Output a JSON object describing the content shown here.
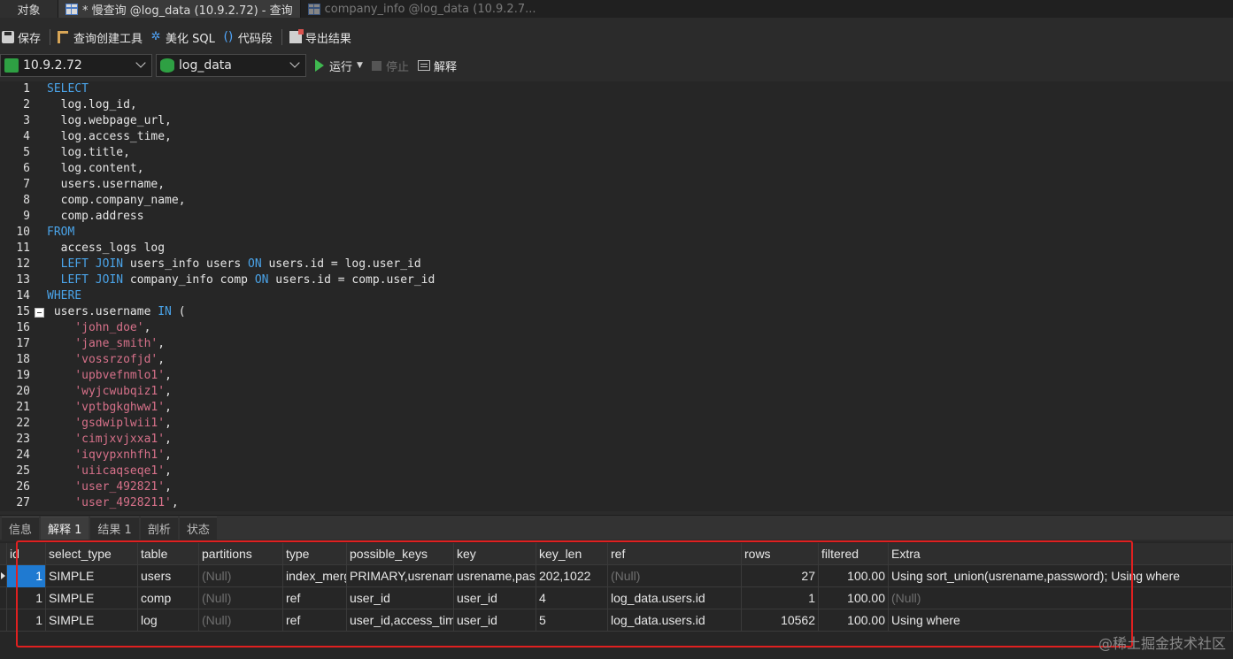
{
  "tabs": [
    {
      "label": "对象",
      "state": "objects"
    },
    {
      "label": "* 慢查询 @log_data (10.9.2.72) - 查询",
      "state": "active"
    },
    {
      "label": "company_info @log_data (10.9.2.7...",
      "state": "inactive"
    }
  ],
  "toolbar": {
    "save": "保存",
    "query_builder": "查询创建工具",
    "beautify": "美化 SQL",
    "snippet": "代码段",
    "export": "导出结果"
  },
  "connection": {
    "value": "10.9.2.72"
  },
  "database": {
    "value": "log_data"
  },
  "run": {
    "label": "运行",
    "stop": "停止",
    "explain": "解释"
  },
  "editor": {
    "lines": [
      [
        {
          "t": "SELECT",
          "c": "kw"
        }
      ],
      [
        {
          "t": "  log.log_id,"
        }
      ],
      [
        {
          "t": "  log.webpage_url,"
        }
      ],
      [
        {
          "t": "  log.access_time,"
        }
      ],
      [
        {
          "t": "  log.title,"
        }
      ],
      [
        {
          "t": "  log.content,"
        }
      ],
      [
        {
          "t": "  users.username,"
        }
      ],
      [
        {
          "t": "  comp.company_name,"
        }
      ],
      [
        {
          "t": "  comp.address"
        }
      ],
      [
        {
          "t": "FROM",
          "c": "kw"
        }
      ],
      [
        {
          "t": "  access_logs log"
        }
      ],
      [
        {
          "t": "  "
        },
        {
          "t": "LEFT JOIN",
          "c": "kw"
        },
        {
          "t": " users_info users "
        },
        {
          "t": "ON",
          "c": "kw"
        },
        {
          "t": " users.id = log.user_id"
        }
      ],
      [
        {
          "t": "  "
        },
        {
          "t": "LEFT JOIN",
          "c": "kw"
        },
        {
          "t": " company_info comp "
        },
        {
          "t": "ON",
          "c": "kw"
        },
        {
          "t": " users.id = comp.user_id"
        }
      ],
      [
        {
          "t": "WHERE",
          "c": "kw"
        }
      ],
      [
        {
          "t": " users.username "
        },
        {
          "t": "IN",
          "c": "kw"
        },
        {
          "t": " ("
        }
      ],
      [
        {
          "t": "    "
        },
        {
          "t": "'john_doe'",
          "c": "str"
        },
        {
          "t": ","
        }
      ],
      [
        {
          "t": "    "
        },
        {
          "t": "'jane_smith'",
          "c": "str"
        },
        {
          "t": ","
        }
      ],
      [
        {
          "t": "    "
        },
        {
          "t": "'vossrzofjd'",
          "c": "str"
        },
        {
          "t": ","
        }
      ],
      [
        {
          "t": "    "
        },
        {
          "t": "'upbvefnmlo1'",
          "c": "str"
        },
        {
          "t": ","
        }
      ],
      [
        {
          "t": "    "
        },
        {
          "t": "'wyjcwubqiz1'",
          "c": "str"
        },
        {
          "t": ","
        }
      ],
      [
        {
          "t": "    "
        },
        {
          "t": "'vptbgkghww1'",
          "c": "str"
        },
        {
          "t": ","
        }
      ],
      [
        {
          "t": "    "
        },
        {
          "t": "'gsdwiplwii1'",
          "c": "str"
        },
        {
          "t": ","
        }
      ],
      [
        {
          "t": "    "
        },
        {
          "t": "'cimjxvjxxa1'",
          "c": "str"
        },
        {
          "t": ","
        }
      ],
      [
        {
          "t": "    "
        },
        {
          "t": "'iqvypxnhfh1'",
          "c": "str"
        },
        {
          "t": ","
        }
      ],
      [
        {
          "t": "    "
        },
        {
          "t": "'uiicaqseqe1'",
          "c": "str"
        },
        {
          "t": ","
        }
      ],
      [
        {
          "t": "    "
        },
        {
          "t": "'user_492821'",
          "c": "str"
        },
        {
          "t": ","
        }
      ],
      [
        {
          "t": "    "
        },
        {
          "t": "'user_4928211'",
          "c": "str"
        },
        {
          "t": ","
        }
      ]
    ]
  },
  "result_tabs": [
    {
      "label": "信息",
      "active": false
    },
    {
      "label": "解释 1",
      "active": true
    },
    {
      "label": "结果 1",
      "active": false
    },
    {
      "label": "剖析",
      "active": false
    },
    {
      "label": "状态",
      "active": false
    }
  ],
  "grid": {
    "columns": [
      "id",
      "select_type",
      "table",
      "partitions",
      "type",
      "possible_keys",
      "key",
      "key_len",
      "ref",
      "rows",
      "filtered",
      "Extra"
    ],
    "rows": [
      [
        "1",
        "SIMPLE",
        "users",
        "(Null)",
        "index_merge",
        "PRIMARY,usrename",
        "usrename,password",
        "202,1022",
        "(Null)",
        "27",
        "100.00",
        "Using sort_union(usrename,password); Using where"
      ],
      [
        "1",
        "SIMPLE",
        "comp",
        "(Null)",
        "ref",
        "user_id",
        "user_id",
        "4",
        "log_data.users.id",
        "1",
        "100.00",
        "(Null)"
      ],
      [
        "1",
        "SIMPLE",
        "log",
        "(Null)",
        "ref",
        "user_id,access_time",
        "user_id",
        "5",
        "log_data.users.id",
        "10562",
        "100.00",
        "Using where"
      ]
    ]
  },
  "watermark": "@稀土掘金技术社区"
}
